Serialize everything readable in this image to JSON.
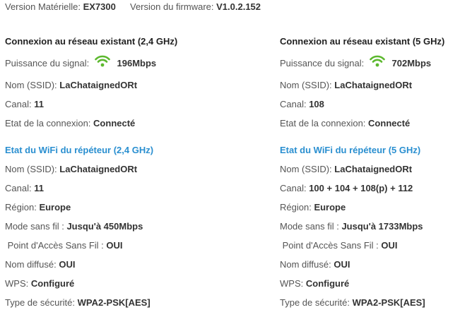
{
  "top": {
    "hw_label": "Version Matérielle:",
    "hw_value": "EX7300",
    "fw_label": "Version du firmware:",
    "fw_value": "V1.0.2.152"
  },
  "colors": {
    "accent_blue": "#2a8fd0",
    "signal_green": "#5cb82e"
  },
  "icons": {
    "signal": "wifi-signal-icon"
  },
  "band24": {
    "existing": {
      "title": "Connexion au réseau existant (2,4 GHz)",
      "signal_label": "Puissance du signal:",
      "signal_value": "196Mbps",
      "ssid_label": "Nom (SSID):",
      "ssid_value": "LaChataignedORt",
      "channel_label": "Canal:",
      "channel_value": "11",
      "state_label": "Etat de la connexion:",
      "state_value": "Connecté"
    },
    "repeater": {
      "title": "Etat du WiFi du répéteur (2,4 GHz)",
      "ssid_label": "Nom (SSID):",
      "ssid_value": "LaChataignedORt",
      "channel_label": "Canal:",
      "channel_value": "11",
      "region_label": "Région:",
      "region_value": "Europe",
      "mode_label": "Mode sans fil :",
      "mode_value": "Jusqu'à 450Mbps",
      "ap_label": " Point d'Accès Sans Fil :",
      "ap_value": "OUI",
      "broadcast_label": "Nom diffusé:",
      "broadcast_value": "OUI",
      "wps_label": "WPS:",
      "wps_value": "Configuré",
      "security_label": "Type de sécurité:",
      "security_value": "WPA2-PSK[AES]"
    }
  },
  "band5": {
    "existing": {
      "title": "Connexion au réseau existant (5 GHz)",
      "signal_label": "Puissance du signal:",
      "signal_value": "702Mbps",
      "ssid_label": "Nom (SSID):",
      "ssid_value": "LaChataignedORt",
      "channel_label": "Canal:",
      "channel_value": "108",
      "state_label": "Etat de la connexion:",
      "state_value": "Connecté"
    },
    "repeater": {
      "title": "Etat du WiFi du répéteur (5 GHz)",
      "ssid_label": "Nom (SSID):",
      "ssid_value": "LaChataignedORt",
      "channel_label": "Canal:",
      "channel_value": "100 + 104 + 108(p) + 112",
      "region_label": "Région:",
      "region_value": "Europe",
      "mode_label": "Mode sans fil :",
      "mode_value": "Jusqu'à 1733Mbps",
      "ap_label": " Point d'Accès Sans Fil :",
      "ap_value": "OUI",
      "broadcast_label": "Nom diffusé:",
      "broadcast_value": "OUI",
      "wps_label": "WPS:",
      "wps_value": "Configuré",
      "security_label": "Type de sécurité:",
      "security_value": "WPA2-PSK[AES]"
    }
  }
}
